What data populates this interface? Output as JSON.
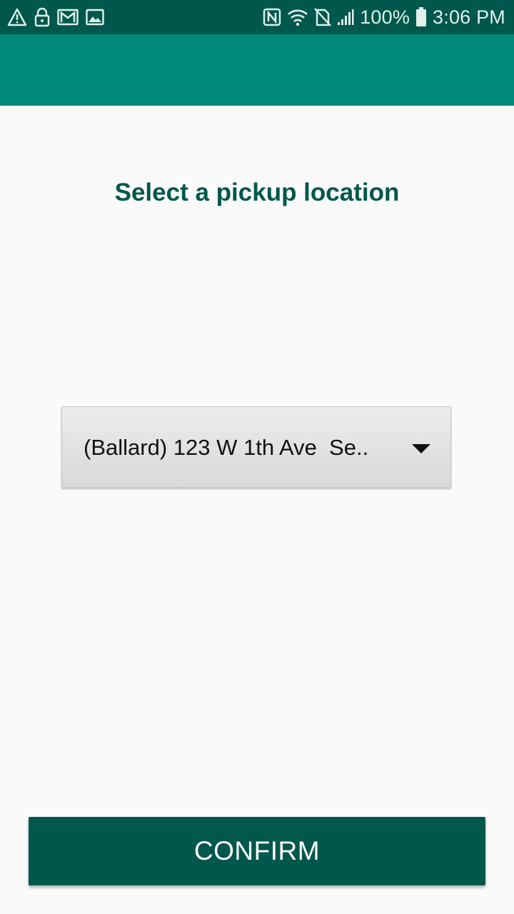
{
  "status_bar": {
    "left_icons": [
      "warning-icon",
      "lock-icon",
      "gmail-icon",
      "image-icon"
    ],
    "right_icons": [
      "nfc-icon",
      "wifi-icon",
      "no-sim-icon",
      "signal-icon",
      "battery-icon"
    ],
    "battery_percent": "100%",
    "time": "3:06 PM",
    "background_color": "#00574b"
  },
  "app_bar": {
    "background_color": "#00897b"
  },
  "main": {
    "title": "Select a pickup location",
    "location_spinner": {
      "selected_value": "(Ballard) 123 W 1th Ave  Se.."
    },
    "confirm_label": "CONFIRM"
  },
  "colors": {
    "primary_dark": "#00574b",
    "primary": "#00897b",
    "background": "#fafafa"
  }
}
